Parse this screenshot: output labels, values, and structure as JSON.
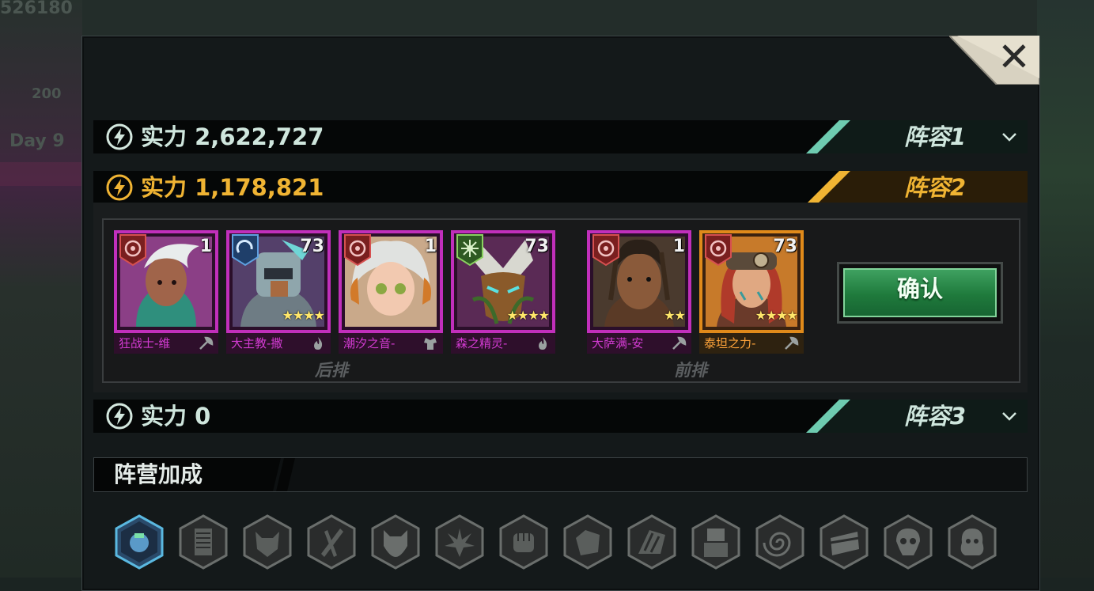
{
  "background": {
    "top_left_number": "526180",
    "left_number": "200",
    "left_day": "Day 9"
  },
  "teams": [
    {
      "power_label": "实力",
      "power_value": "2,622,727",
      "tab_label": "阵容1",
      "state": "collapsed"
    },
    {
      "power_label": "实力",
      "power_value": "1,178,821",
      "tab_label": "阵容2",
      "state": "expanded"
    },
    {
      "power_label": "实力",
      "power_value": "0",
      "tab_label": "阵容3",
      "state": "collapsed"
    }
  ],
  "heroes": [
    {
      "name": "狂战士-维",
      "level": "1",
      "stars": "",
      "rarity": "purple",
      "faction": "red-target",
      "class": "axe-icon"
    },
    {
      "name": "大主教-撒",
      "level": "73",
      "stars": "★★★★",
      "rarity": "purple",
      "faction": "blue-tech",
      "class": "flame-icon"
    },
    {
      "name": "潮汐之音-",
      "level": "1",
      "stars": "",
      "rarity": "purple",
      "faction": "red-target",
      "class": "armor-icon"
    },
    {
      "name": "森之精灵-",
      "level": "73",
      "stars": "★★★★",
      "rarity": "purple",
      "faction": "green-nature",
      "class": "flame-icon"
    },
    {
      "name": "大萨满-安",
      "level": "1",
      "stars": "★★",
      "rarity": "purple",
      "faction": "red-target",
      "class": "axe-icon"
    },
    {
      "name": "泰坦之力-",
      "level": "73",
      "stars": "★★★★",
      "rarity": "orange",
      "faction": "red-target",
      "class": "axe-icon"
    }
  ],
  "row_labels": {
    "back": "后排",
    "front": "前排"
  },
  "confirm_label": "确认",
  "faction_section": {
    "title": "阵营加成",
    "icons": [
      "mech-faction-icon",
      "scroll-faction-icon",
      "beast-faction-icon",
      "blade-faction-icon",
      "dog-faction-icon",
      "plant-faction-icon",
      "fist-faction-icon",
      "tank-faction-icon",
      "wing-faction-icon",
      "robot-faction-icon",
      "spiral-faction-icon",
      "chest-faction-icon",
      "skull-faction-icon",
      "ghost-faction-icon"
    ]
  },
  "colors": {
    "purple_frame": "#c12fbb",
    "orange_frame": "#e08a1a",
    "gold_text": "#f0b433",
    "green_accent": "#5fc8a8",
    "confirm_green": "#1f7a3c"
  }
}
